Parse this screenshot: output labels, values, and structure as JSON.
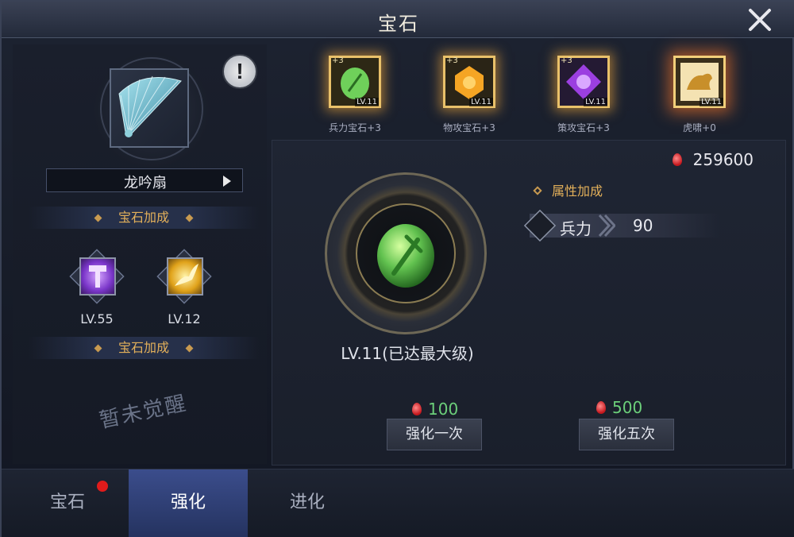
{
  "window": {
    "title": "宝石"
  },
  "weapon": {
    "name": "龙吟扇"
  },
  "left": {
    "bonus_label_1": "宝石加成",
    "bonus_label_2": "宝石加成",
    "skills": [
      {
        "level": "LV.55",
        "icon": "purple-hammer-icon"
      },
      {
        "level": "LV.12",
        "icon": "golden-dragon-icon"
      }
    ],
    "not_awakened": "暂未觉醒"
  },
  "slots": [
    {
      "label": "兵力宝石+3",
      "plus": "+3",
      "level": "LV.11",
      "color": "#55c84d",
      "icon": "green-gem-icon"
    },
    {
      "label": "物攻宝石+3",
      "plus": "+3",
      "level": "LV.11",
      "color": "#f5a524",
      "icon": "orange-gem-icon"
    },
    {
      "label": "策攻宝石+3",
      "plus": "+3",
      "level": "LV.11",
      "color": "#9b3fe0",
      "icon": "purple-gem-icon"
    },
    {
      "label": "虎啸+0",
      "plus": "",
      "level": "LV.11",
      "color": "#e9c16a",
      "icon": "tiger-emblem-icon"
    }
  ],
  "currency": {
    "amount": "259600",
    "icon": "red-gem-icon"
  },
  "attributes": {
    "title": "属性加成",
    "rows": [
      {
        "name": "兵力",
        "value": "90",
        "icon": "crossed-swords-icon"
      }
    ]
  },
  "gem": {
    "level_text": "LV.11(已达最大级)",
    "color": "#61c14f"
  },
  "actions": {
    "once": {
      "cost": "100",
      "label": "强化一次"
    },
    "five": {
      "cost": "500",
      "label": "强化五次"
    }
  },
  "tabs": [
    {
      "label": "宝石",
      "active": false,
      "badge": true
    },
    {
      "label": "强化",
      "active": true,
      "badge": false
    },
    {
      "label": "进化",
      "active": false,
      "badge": false
    }
  ],
  "colors": {
    "accent_gold": "#e3b05a",
    "cost_green": "#6ccf7a",
    "tab_active": "#3b4d8c",
    "badge_red": "#e01b1b"
  }
}
